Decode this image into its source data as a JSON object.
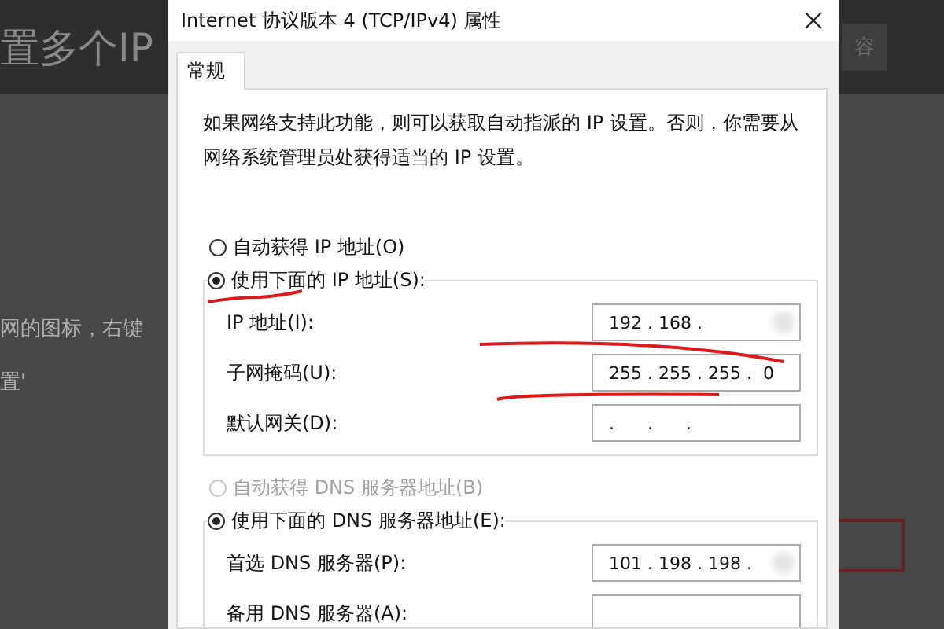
{
  "backdrop": {
    "heading": "置多个IP",
    "search_text": "容",
    "body_lines": [
      "网的图标，右键",
      "置'"
    ]
  },
  "window": {
    "title": "Internet 协议版本 4 (TCP/IPv4) 属性"
  },
  "tabs": [
    {
      "label": "常规",
      "selected": true
    }
  ],
  "description": "如果网络支持此功能，则可以获取自动指派的 IP 设置。否则，你需要从网络系统管理员处获得适当的 IP 设置。",
  "ip_options": [
    {
      "label": "自动获得 IP 地址(O)",
      "selected": false,
      "disabled": false
    },
    {
      "label": "使用下面的 IP 地址(S):",
      "selected": true,
      "disabled": false
    }
  ],
  "ip_fields": [
    {
      "label": "IP 地址(I):",
      "value": "192 . 168 .",
      "obscured": true
    },
    {
      "label": "子网掩码(U):",
      "value": "255 . 255 . 255 .  0",
      "obscured": false
    },
    {
      "label": "默认网关(D):",
      "value": ".      .      .",
      "obscured": false
    }
  ],
  "dns_options": [
    {
      "label": "自动获得 DNS 服务器地址(B)",
      "selected": false,
      "disabled": true
    },
    {
      "label": "使用下面的 DNS 服务器地址(E):",
      "selected": true,
      "disabled": false
    }
  ],
  "dns_fields": [
    {
      "label": "首选 DNS 服务器(P):",
      "value": "101 . 198 . 198 .",
      "obscured": true
    },
    {
      "label": "备用 DNS 服务器(A):",
      "obscured": false
    }
  ]
}
